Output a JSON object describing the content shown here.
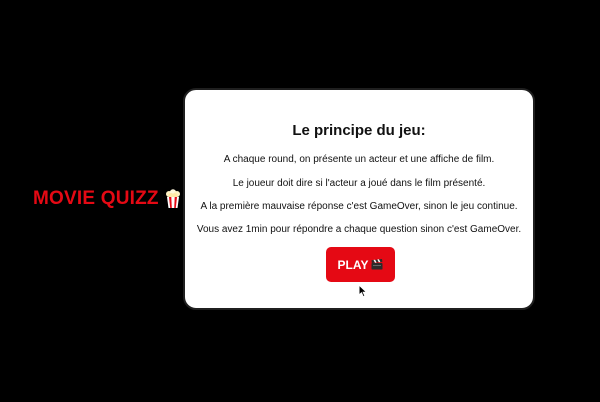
{
  "logo": {
    "text": "MOVIE QUIZZ",
    "icon": "popcorn-icon"
  },
  "card": {
    "title": "Le principe du jeu:",
    "rules": [
      "A chaque round, on présente un acteur et une affiche de film.",
      "Le joueur doit dire si l'acteur a joué dans le film présenté.",
      "A la première mauvaise réponse c'est GameOver, sinon le jeu continue.",
      "Vous avez 1min pour répondre a chaque question sinon c'est GameOver."
    ],
    "play_button": {
      "label": "PLAY",
      "icon": "clapper-board-icon"
    }
  },
  "colors": {
    "background": "#000000",
    "accent": "#e50914",
    "card": "#ffffff"
  }
}
